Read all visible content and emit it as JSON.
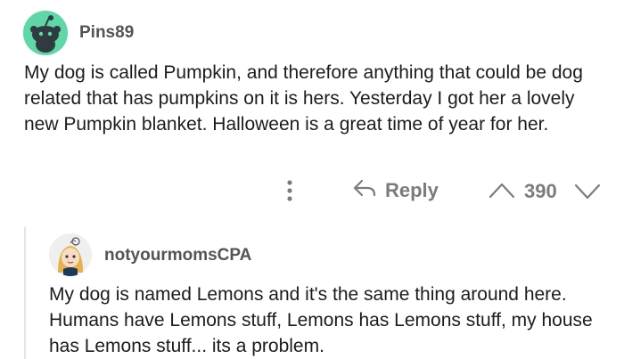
{
  "comment": {
    "username": "Pins89",
    "avatar_icon": "reddit-snoo-avatar",
    "avatar_color": "#5fd7a6",
    "body": "My dog is called Pumpkin, and therefore anything that could be dog related that has pumpkins on it is hers. Yesterday I got her a lovely new Pumpkin blanket. Halloween is a great time of year for her.",
    "actions": {
      "more_icon": "vertical-dots-icon",
      "reply_icon": "reply-arrow-icon",
      "reply_label": "Reply",
      "upvote_icon": "chevron-up-icon",
      "score": "390",
      "downvote_icon": "chevron-down-icon"
    }
  },
  "reply": {
    "username": "notyourmomsCPA",
    "avatar_icon": "cartoon-person-avatar",
    "body": "My dog is named Lemons and it's the same thing around here. Humans have Lemons stuff, Lemons has Lemons stuff, my house has Lemons stuff... its a problem."
  },
  "colors": {
    "text": "#1c1c1c",
    "meta": "#7c7c7c",
    "thread_line": "#e4e4e4"
  }
}
